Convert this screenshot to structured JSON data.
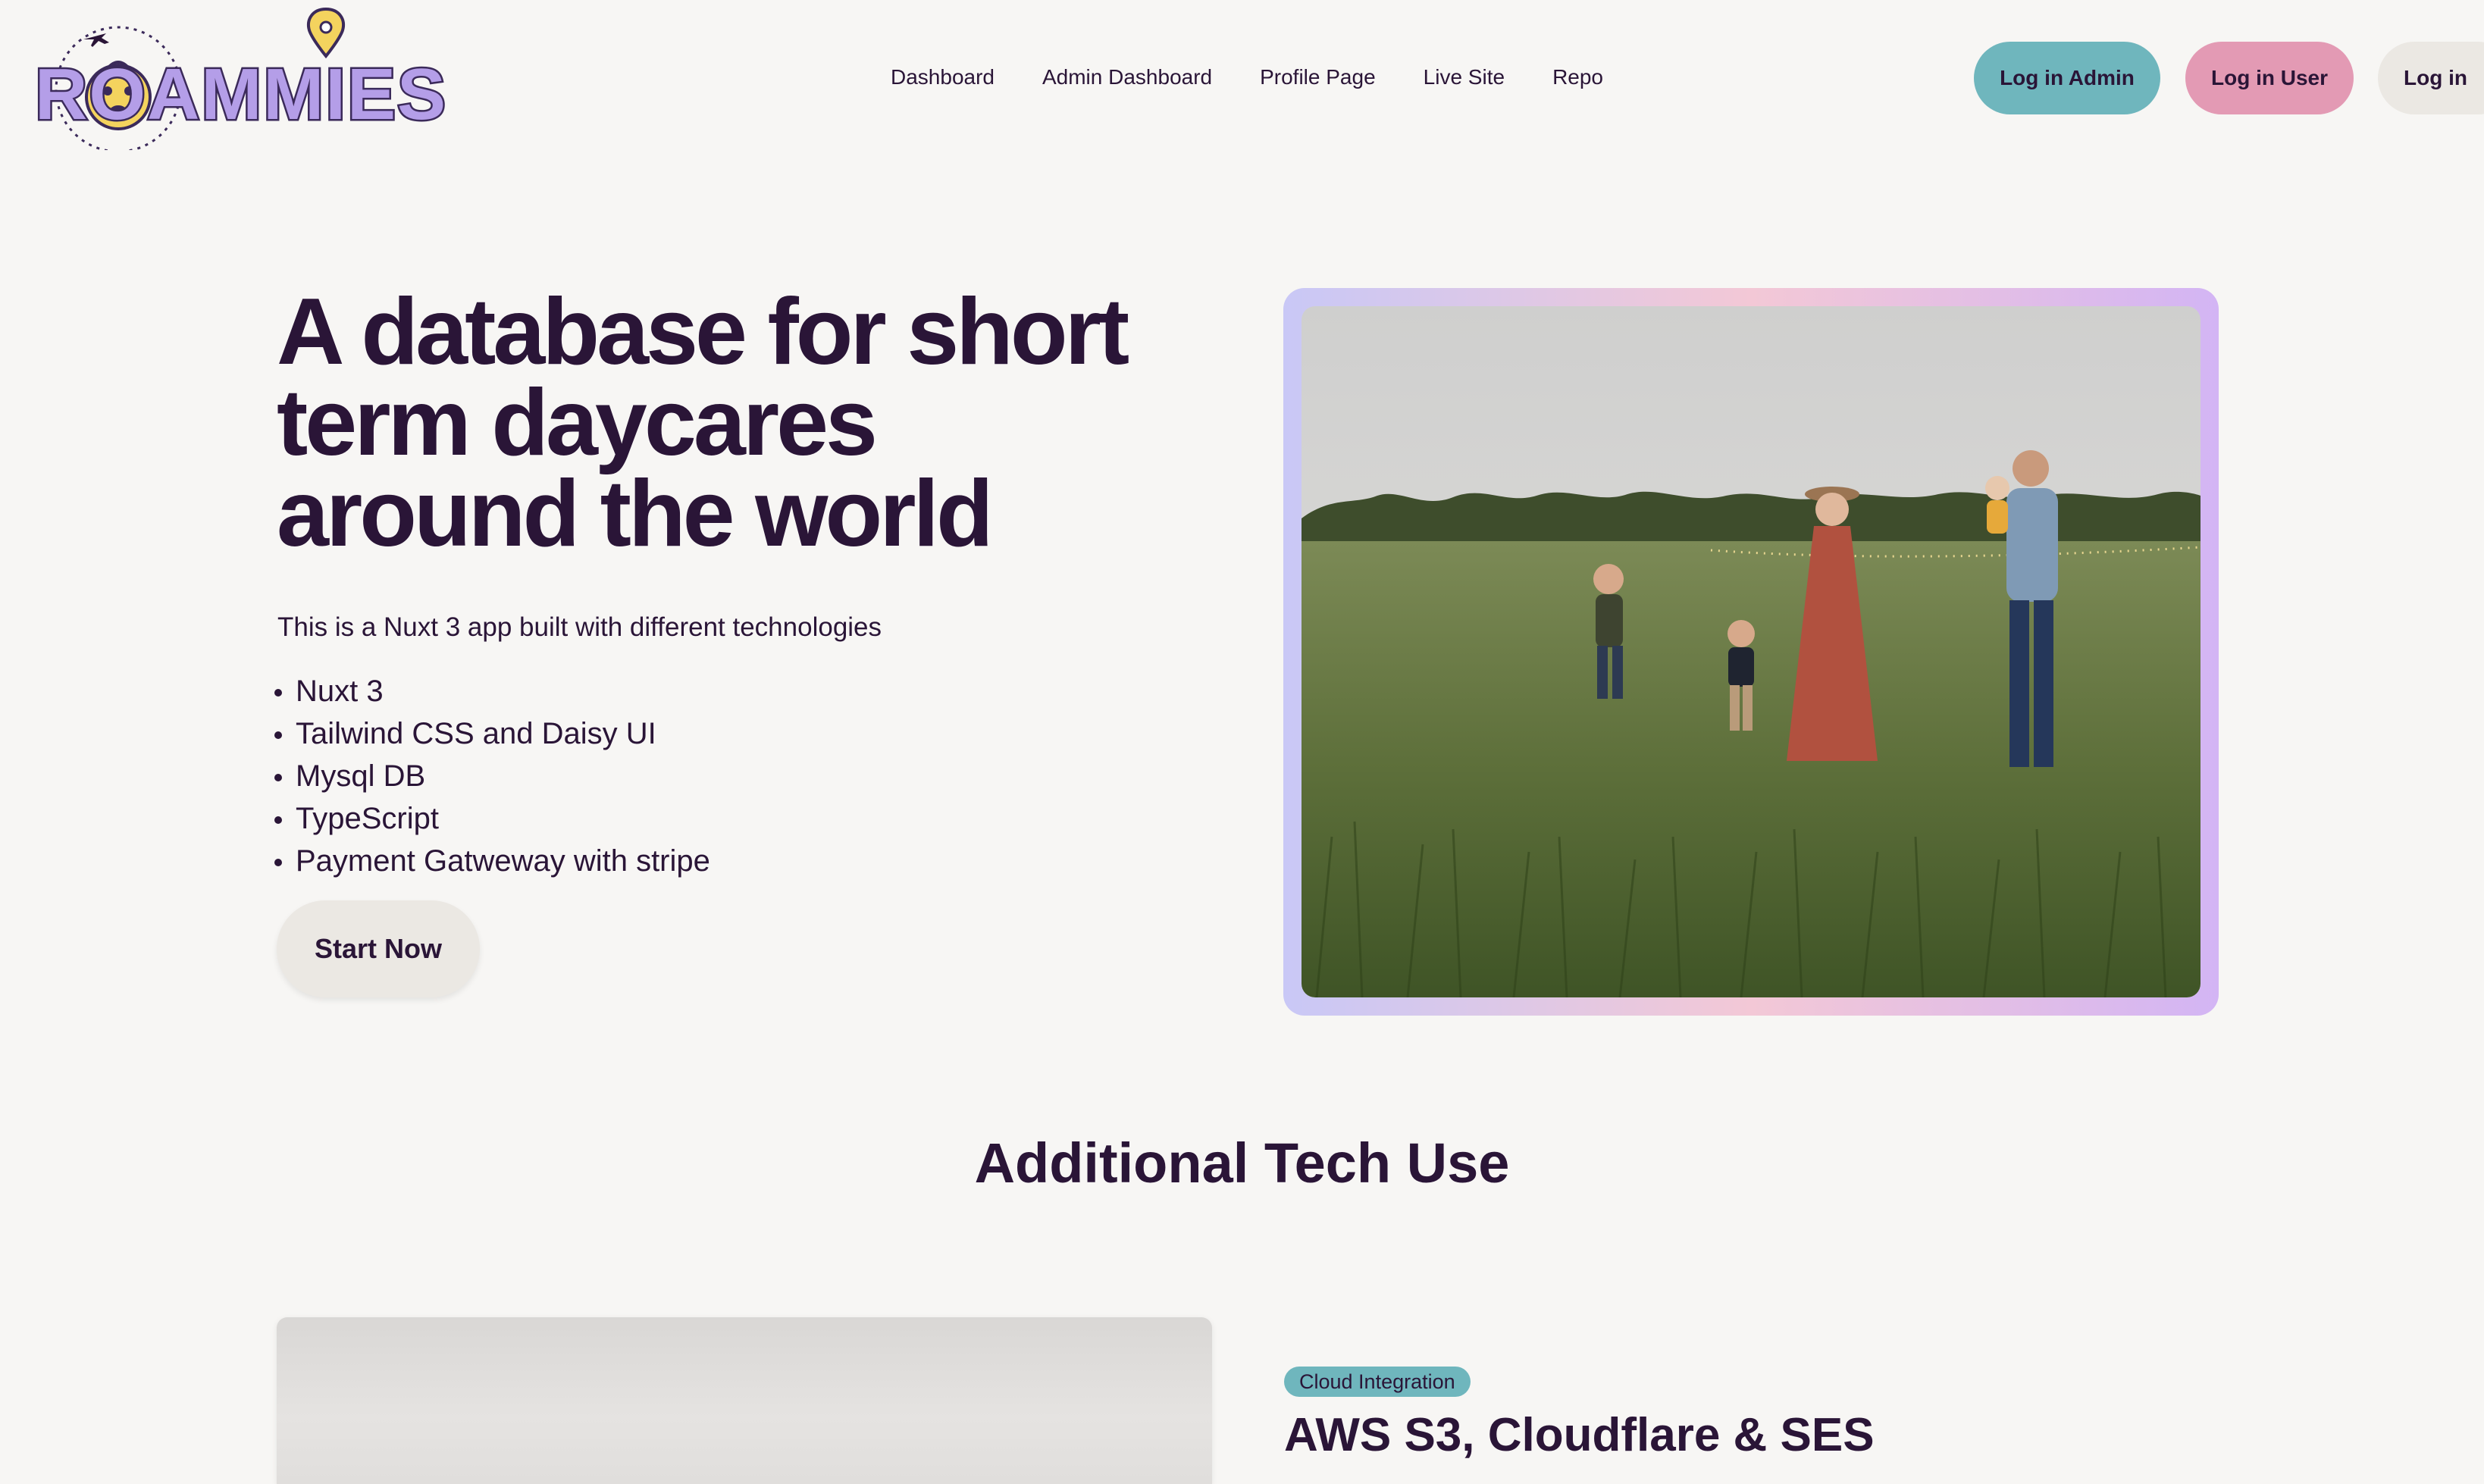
{
  "brand": {
    "logo_text": "ROAMMIES",
    "logo_accent_color": "#b49ee8",
    "logo_outline_color": "#3b2a5a"
  },
  "nav": {
    "links": [
      "Dashboard",
      "Admin Dashboard",
      "Profile Page",
      "Live Site",
      "Repo"
    ],
    "buttons": {
      "admin": "Log in Admin",
      "user": "Log in User",
      "login": "Log in"
    }
  },
  "hero": {
    "title": "A database for short term daycares around the world",
    "intro": "This is a Nuxt 3 app built with different technologies",
    "tech_list": [
      "Nuxt 3",
      "Tailwind CSS and Daisy UI",
      "Mysql DB",
      "TypeScript",
      "Payment Gatweway with stripe"
    ],
    "cta": "Start Now"
  },
  "section": {
    "title": "Additional Tech Use",
    "badge": "Cloud Integration",
    "feature_title": "AWS S3, Cloudflare & SES"
  },
  "colors": {
    "text": "#2a1537",
    "background": "#f7f6f4",
    "admin_button": "#6fb6bd",
    "user_button": "#e39ab4",
    "neutral_button": "#ebe8e3"
  }
}
